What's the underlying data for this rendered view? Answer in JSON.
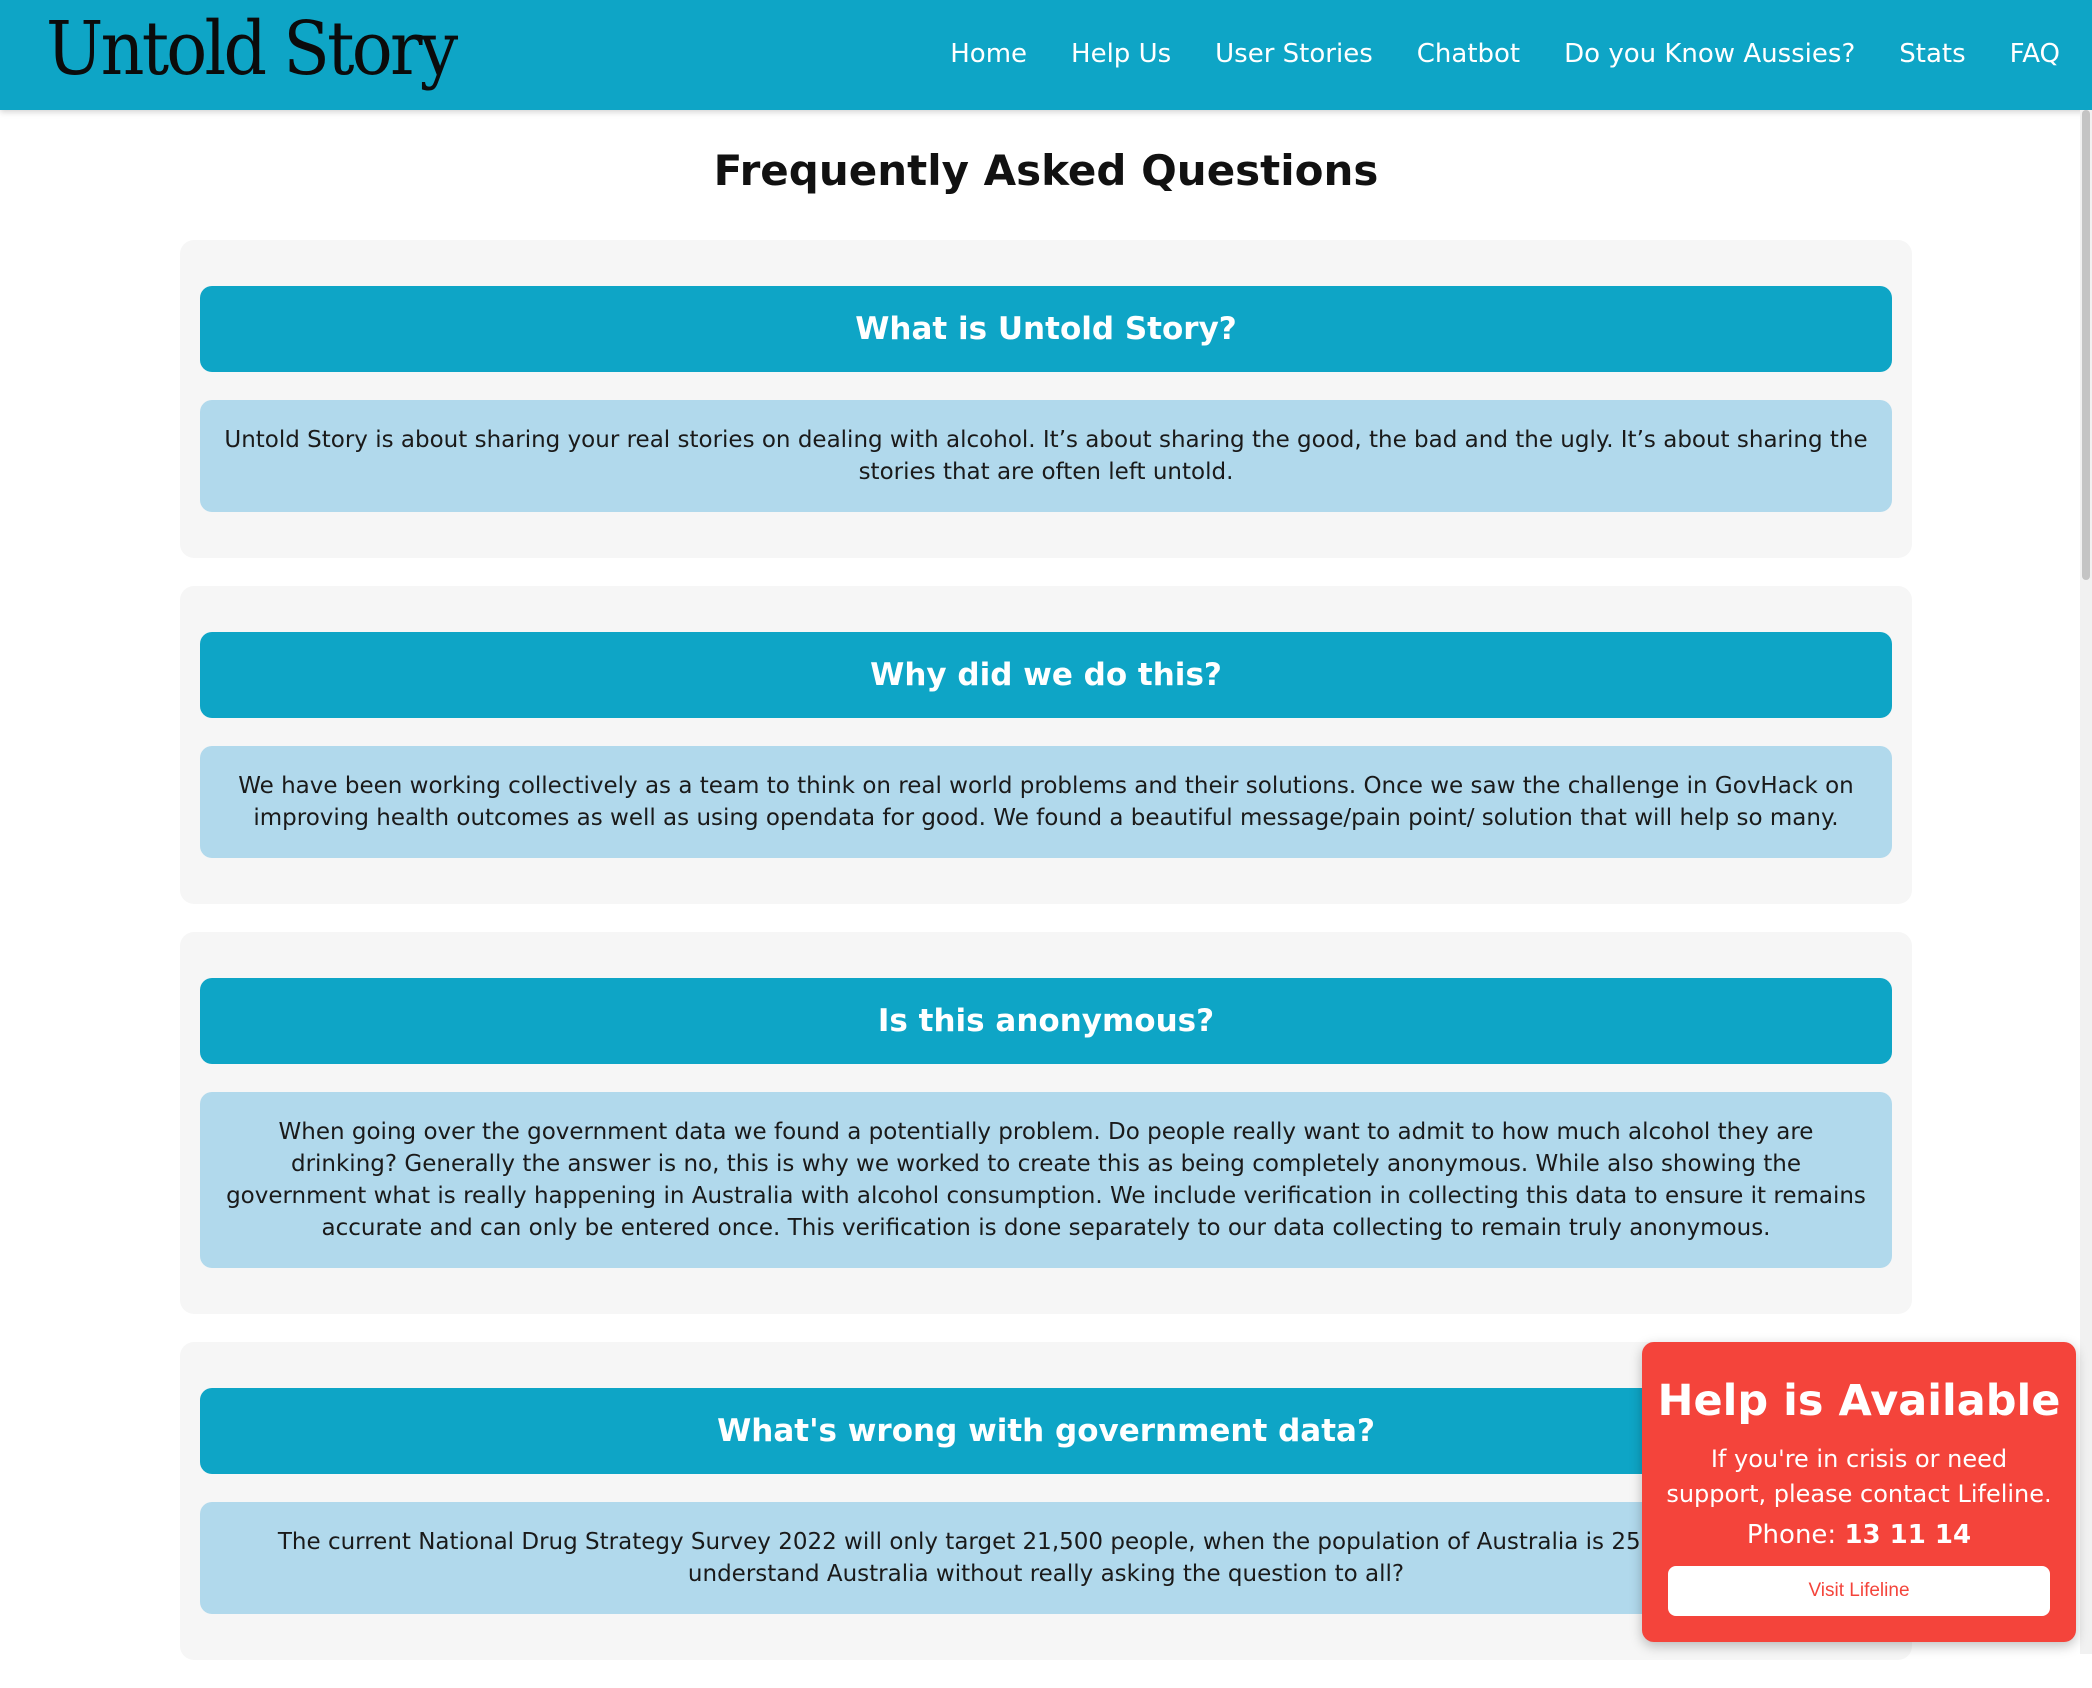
{
  "brand": {
    "logo_text": "Untold Story"
  },
  "nav": {
    "items": [
      {
        "label": "Home"
      },
      {
        "label": "Help Us"
      },
      {
        "label": "User Stories"
      },
      {
        "label": "Chatbot"
      },
      {
        "label": "Do you Know Aussies?"
      },
      {
        "label": "Stats"
      },
      {
        "label": "FAQ"
      }
    ]
  },
  "page": {
    "title": "Frequently Asked Questions"
  },
  "faqs": [
    {
      "question": "What is Untold Story?",
      "answer": "Untold Story is about sharing your real stories on dealing with alcohol. It’s about sharing the good, the bad and the ugly. It’s about sharing the stories that are often left untold."
    },
    {
      "question": "Why did we do this?",
      "answer": "We have been working collectively as a team to think on real world problems and their solutions. Once we saw the challenge in GovHack on improving health outcomes as well as using opendata for good. We found a beautiful message/pain point/ solution that will help so many."
    },
    {
      "question": "Is this anonymous?",
      "answer": "When going over the government data we found a potentially problem. Do people really want to admit to how much alcohol they are drinking? Generally the answer is no, this is why we worked to create this as being completely anonymous. While also showing the government what is really happening in Australia with alcohol consumption. We include verification in collecting this data to ensure it remains accurate and can only be entered once. This verification is done separately to our data collecting to remain truly anonymous."
    },
    {
      "question": "What's wrong with government data?",
      "answer": "The current National Drug Strategy Survey 2022 will only target 21,500 people, when the population of Australia is 25,422,788 peopl understand Australia without really asking the question to all?"
    }
  ],
  "help": {
    "title": "Help is Available",
    "text": "If you're in crisis or need support, please contact Lifeline.",
    "phone_label": "Phone:",
    "phone_number": "13 11 14",
    "button_label": "Visit Lifeline"
  },
  "colors": {
    "brand": "#0ea5c6",
    "answer_bg": "#b1d9ec",
    "card_bg": "#f6f6f6",
    "alert": "#f4443b"
  }
}
